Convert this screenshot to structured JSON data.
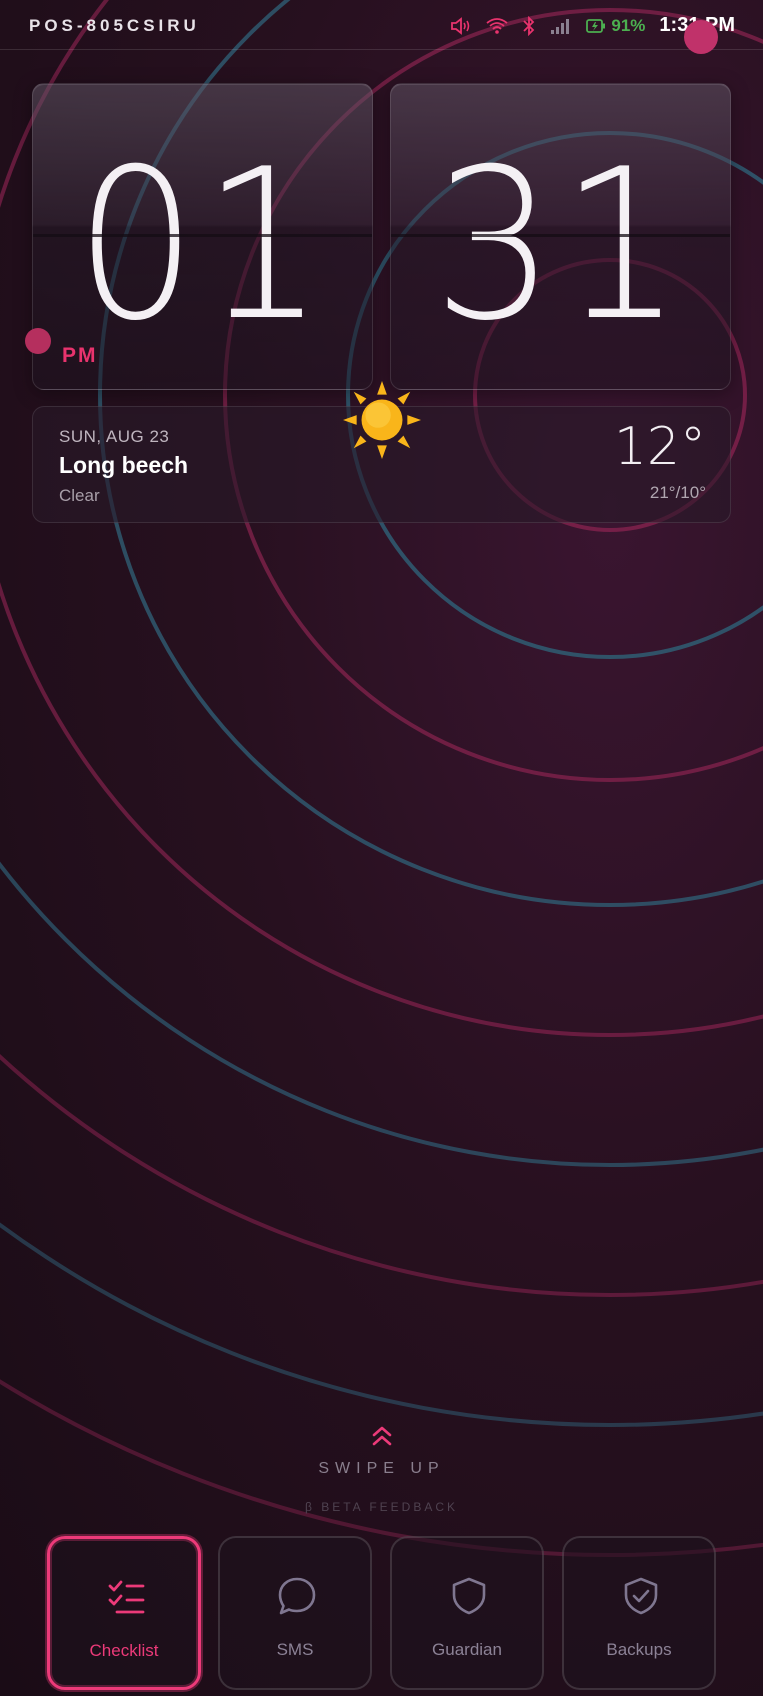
{
  "status_bar": {
    "device_id": "POS-805CSIRU",
    "battery": "91%",
    "time": "1:31 PM",
    "icons": [
      "speaker-icon",
      "wifi-icon",
      "bluetooth-icon",
      "signal-icon",
      "battery-icon"
    ]
  },
  "clock": {
    "hours": "01",
    "minutes": "31",
    "ampm": "PM"
  },
  "weather": {
    "date": "SUN, AUG 23",
    "city": "Long beech",
    "condition": "Clear",
    "temperature": "12°",
    "range": "21°/10°",
    "icon": "sun-icon"
  },
  "swipe": {
    "label": "SWIPE UP",
    "beta": "β BETA FEEDBACK"
  },
  "nav": [
    {
      "label": "Checklist",
      "icon": "checklist-icon",
      "active": true
    },
    {
      "label": "SMS",
      "icon": "chat-bubble-icon",
      "active": false
    },
    {
      "label": "Guardian",
      "icon": "shield-icon",
      "active": false
    },
    {
      "label": "Backups",
      "icon": "shield-check-icon",
      "active": false
    }
  ],
  "colors": {
    "accent": "#ec3a79",
    "battery": "#4caf50",
    "sun": "#f9b51a",
    "ring_pink": "#a8285a",
    "ring_teal": "#2f5d73"
  }
}
